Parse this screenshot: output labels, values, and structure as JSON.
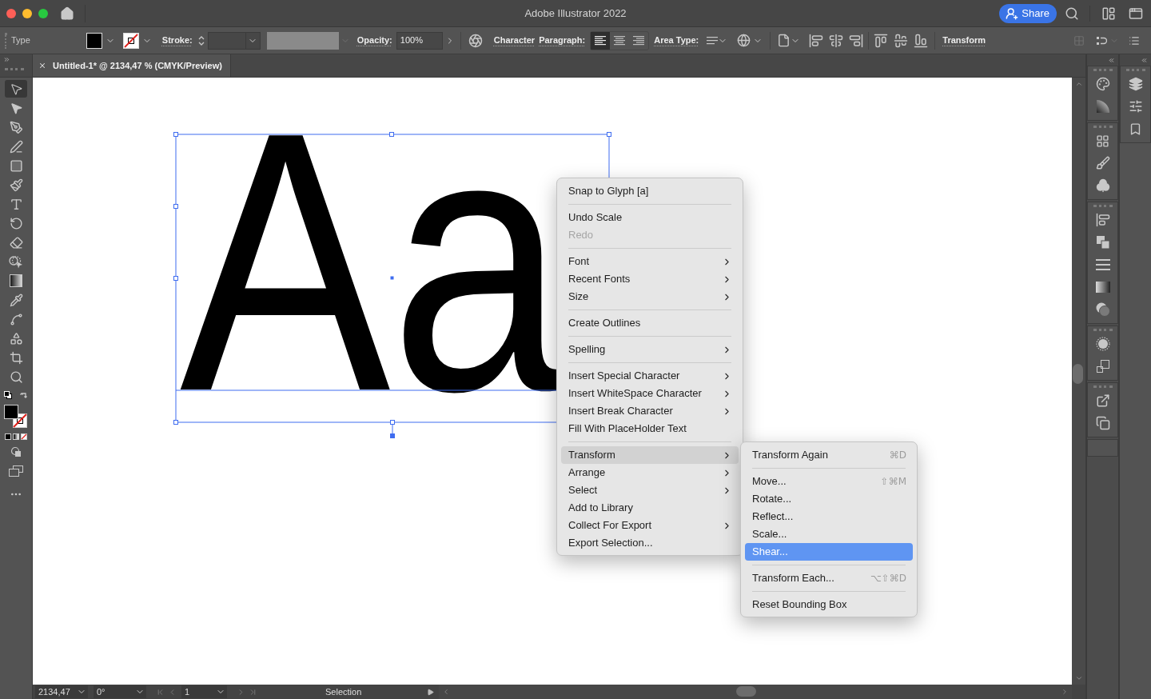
{
  "window": {
    "title": "Adobe Illustrator 2022",
    "share_button": "Share"
  },
  "control_bar": {
    "selection_type": "Type",
    "stroke_label": "Stroke:",
    "profile_dropdown": {
      "disabled": true
    },
    "opacity_label": "Opacity:",
    "opacity_value": "100%",
    "character_link": "Character",
    "paragraph_link": "Paragraph:",
    "paragraph_alignment": [
      {
        "selected": true
      },
      {
        "selected": false
      },
      {
        "selected": false
      }
    ],
    "area_type_link": "Area Type:",
    "transform_link": "Transform"
  },
  "document_tab": {
    "title": "Untitled-1* @ 2134,47 % (CMYK/Preview)"
  },
  "tools": [
    {
      "selected": true
    },
    {
      "selected": false
    },
    {
      "selected": false
    },
    {
      "selected": false
    },
    {
      "selected": false
    },
    {
      "selected": false
    },
    {
      "selected": false
    },
    {
      "selected": false
    },
    {
      "selected": false
    },
    {
      "selected": false
    },
    {
      "selected": false
    },
    {
      "selected": false
    },
    {
      "selected": false
    },
    {
      "selected": false
    },
    {
      "selected": false
    },
    {
      "selected": false
    }
  ],
  "canvas": {
    "text": "Aa"
  },
  "context_menu": {
    "groups": [
      [
        {
          "label": "Snap to Glyph [a]",
          "submenu": false,
          "disabled": false,
          "selected": false
        }
      ],
      [
        {
          "label": "Undo Scale",
          "submenu": false,
          "disabled": false,
          "selected": false
        },
        {
          "label": "Redo",
          "submenu": false,
          "disabled": true,
          "selected": false
        }
      ],
      [
        {
          "label": "Font",
          "submenu": true,
          "disabled": false,
          "selected": false
        },
        {
          "label": "Recent Fonts",
          "submenu": true,
          "disabled": false,
          "selected": false
        },
        {
          "label": "Size",
          "submenu": true,
          "disabled": false,
          "selected": false
        }
      ],
      [
        {
          "label": "Create Outlines",
          "submenu": false,
          "disabled": false,
          "selected": false
        }
      ],
      [
        {
          "label": "Spelling",
          "submenu": true,
          "disabled": false,
          "selected": false
        }
      ],
      [
        {
          "label": "Insert Special Character",
          "submenu": true,
          "disabled": false,
          "selected": false
        },
        {
          "label": "Insert WhiteSpace Character",
          "submenu": true,
          "disabled": false,
          "selected": false
        },
        {
          "label": "Insert Break Character",
          "submenu": true,
          "disabled": false,
          "selected": false
        },
        {
          "label": "Fill With PlaceHolder Text",
          "submenu": false,
          "disabled": false,
          "selected": false
        }
      ],
      [
        {
          "label": "Transform",
          "submenu": true,
          "disabled": false,
          "selected": true
        },
        {
          "label": "Arrange",
          "submenu": true,
          "disabled": false,
          "selected": false
        },
        {
          "label": "Select",
          "submenu": true,
          "disabled": false,
          "selected": false
        },
        {
          "label": "Add to Library",
          "submenu": false,
          "disabled": false,
          "selected": false
        },
        {
          "label": "Collect For Export",
          "submenu": true,
          "disabled": false,
          "selected": false
        },
        {
          "label": "Export Selection...",
          "submenu": false,
          "disabled": false,
          "selected": false
        }
      ]
    ]
  },
  "submenu": {
    "groups": [
      [
        {
          "label": "Transform Again",
          "shortcut": "⌘D",
          "submenu": false,
          "disabled": false,
          "selected": false
        }
      ],
      [
        {
          "label": "Move...",
          "shortcut": "⇧⌘M",
          "submenu": false,
          "disabled": false,
          "selected": false
        },
        {
          "label": "Rotate...",
          "submenu": false,
          "disabled": false,
          "selected": false
        },
        {
          "label": "Reflect...",
          "submenu": false,
          "disabled": false,
          "selected": false
        },
        {
          "label": "Scale...",
          "submenu": false,
          "disabled": false,
          "selected": false
        },
        {
          "label": "Shear...",
          "submenu": false,
          "disabled": false,
          "selected": true
        }
      ],
      [
        {
          "label": "Transform Each...",
          "shortcut": "⌥⇧⌘D",
          "submenu": false,
          "disabled": false,
          "selected": false
        }
      ],
      [
        {
          "label": "Reset Bounding Box",
          "submenu": false,
          "disabled": false,
          "selected": false
        }
      ]
    ]
  },
  "status_bar": {
    "zoom": "2134,47",
    "rotation": "0°",
    "artboard": "1",
    "tool": "Selection"
  }
}
